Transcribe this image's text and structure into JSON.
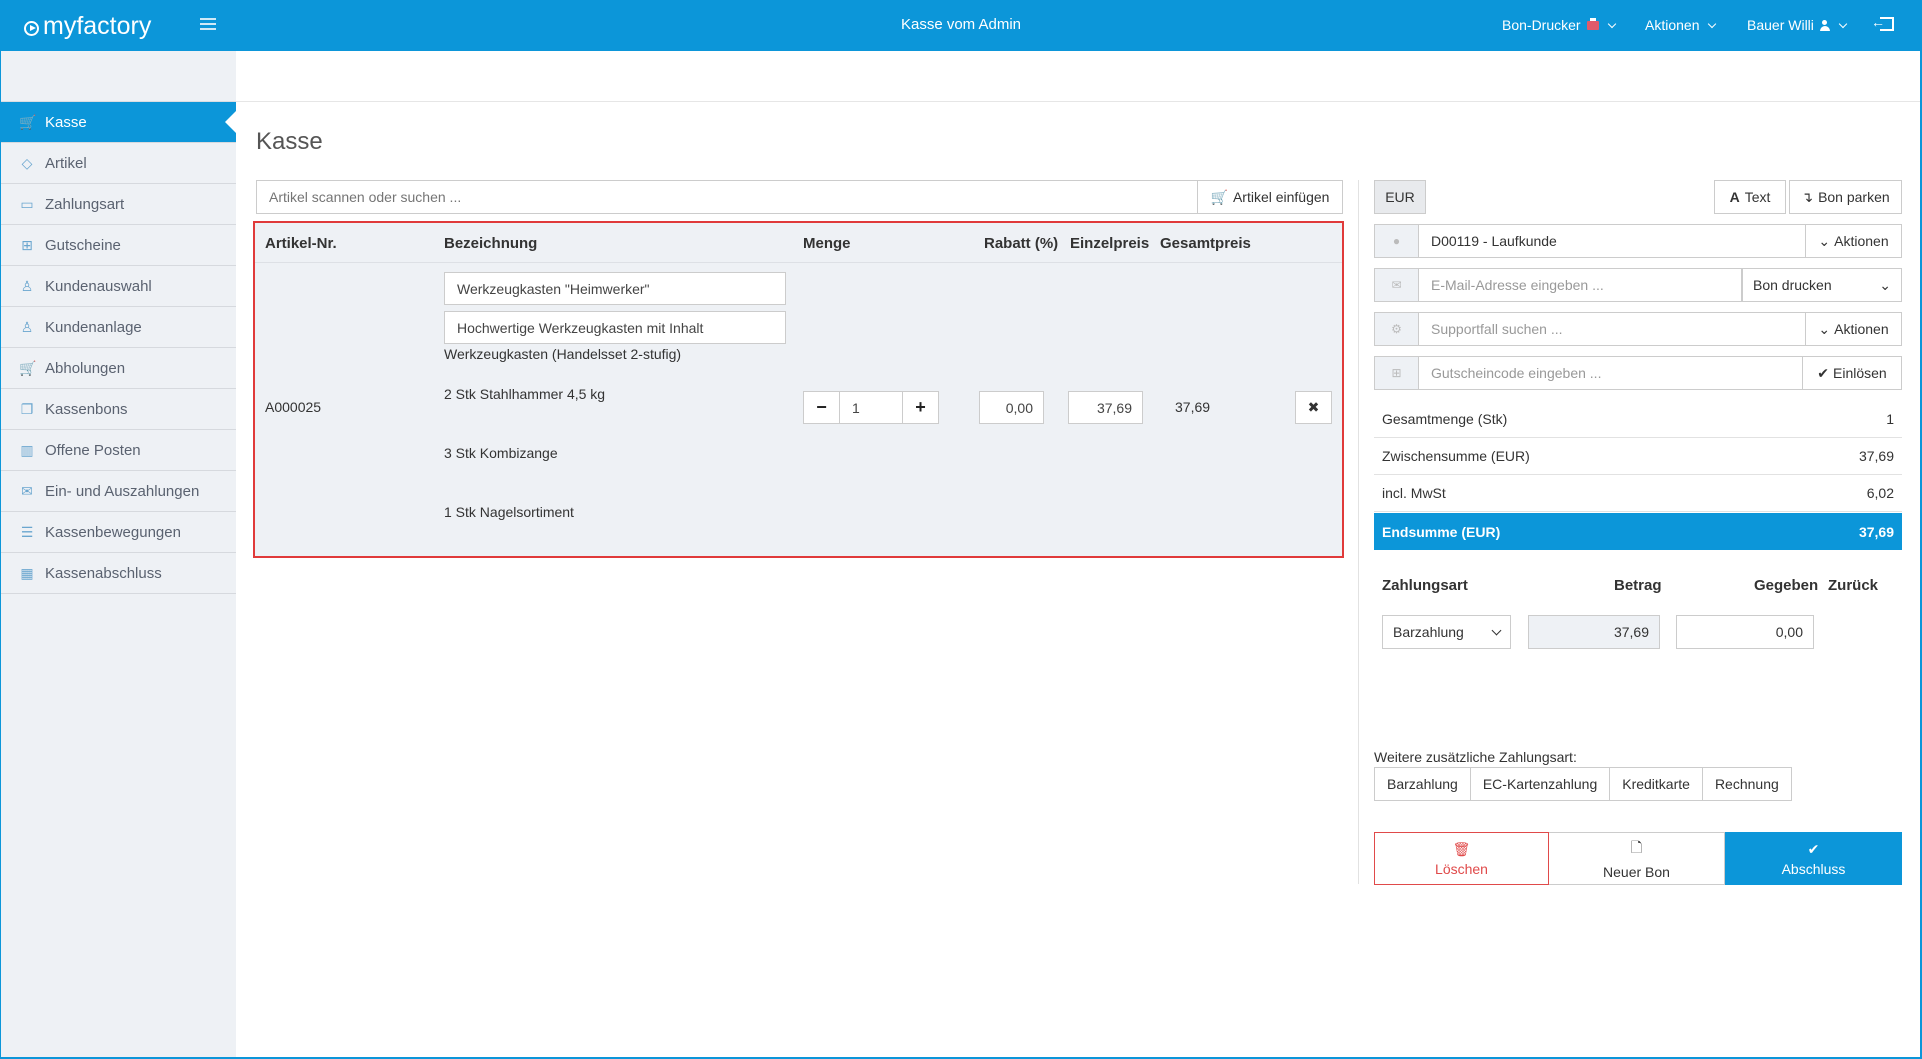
{
  "header": {
    "logo_text": "myfactory",
    "title": "Kasse vom Admin",
    "menu": [
      {
        "label": "Bon-Drucker",
        "icon": "printer-icon"
      },
      {
        "label": "Aktionen"
      },
      {
        "label": "Bauer Willi",
        "icon": "user-icon"
      }
    ]
  },
  "sidebar": {
    "items": [
      {
        "label": "Kasse",
        "icon": "cart-icon",
        "active": true
      },
      {
        "label": "Artikel",
        "icon": "tag-icon"
      },
      {
        "label": "Zahlungsart",
        "icon": "wallet-icon"
      },
      {
        "label": "Gutscheine",
        "icon": "gift-icon"
      },
      {
        "label": "Kundenauswahl",
        "icon": "user-search-icon"
      },
      {
        "label": "Kundenanlage",
        "icon": "user-add-icon"
      },
      {
        "label": "Abholungen",
        "icon": "cart-icon"
      },
      {
        "label": "Kassenbons",
        "icon": "copy-icon"
      },
      {
        "label": "Offene Posten",
        "icon": "book-icon"
      },
      {
        "label": "Ein- und Auszahlungen",
        "icon": "envelope-icon"
      },
      {
        "label": "Kassenbewegungen",
        "icon": "list-icon"
      },
      {
        "label": "Kassenabschluss",
        "icon": "calculator-icon"
      }
    ]
  },
  "main": {
    "title": "Kasse",
    "search_placeholder": "Artikel scannen oder suchen ...",
    "insert_label": "Artikel einfügen",
    "columns": [
      "Artikel-Nr.",
      "Bezeichnung",
      "Menge",
      "Rabatt (%)",
      "Einzelpreis",
      "Gesamtpreis"
    ],
    "row": {
      "article_no": "A000025",
      "name": "Werkzeugkasten \"Heimwerker\"",
      "description": "Hochwertige Werkzeugkasten mit Inhalt",
      "lines": [
        "Werkzeugkasten (Handelsset 2-stufig)",
        "2 Stk Stahlhammer 4,5 kg",
        "3 Stk Kombizange",
        "1 Stk Nagelsortiment"
      ],
      "quantity": "1",
      "discount": "0,00",
      "unit_price": "37,69",
      "total": "37,69"
    }
  },
  "panel": {
    "currency": "EUR",
    "text_label": "Text",
    "park_label": "Bon parken",
    "customer": "D00119 - Laufkunde",
    "actions_label": "Aktionen",
    "email_placeholder": "E-Mail-Adresse eingeben ...",
    "print_option": "Bon drucken",
    "support_placeholder": "Supportfall suchen ...",
    "voucher_placeholder": "Gutscheincode eingeben ...",
    "redeem_label": "Einlösen",
    "summary": [
      {
        "label": "Gesamtmenge (Stk)",
        "value": "1"
      },
      {
        "label": "Zwischensumme (EUR)",
        "value": "37,69"
      },
      {
        "label": "incl. MwSt",
        "value": "6,02"
      }
    ],
    "grand_total": {
      "label": "Endsumme (EUR)",
      "value": "37,69"
    },
    "payment_headers": [
      "Zahlungsart",
      "Betrag",
      "Gegeben",
      "Zurück"
    ],
    "payment": {
      "method": "Barzahlung",
      "amount": "37,69",
      "given": "0,00"
    },
    "more_label": "Weitere zusätzliche Zahlungsart:",
    "more_methods": [
      "Barzahlung",
      "EC-Kartenzahlung",
      "Kreditkarte",
      "Rechnung"
    ],
    "delete_label": "Löschen",
    "new_label": "Neuer Bon",
    "done_label": "Abschluss"
  }
}
